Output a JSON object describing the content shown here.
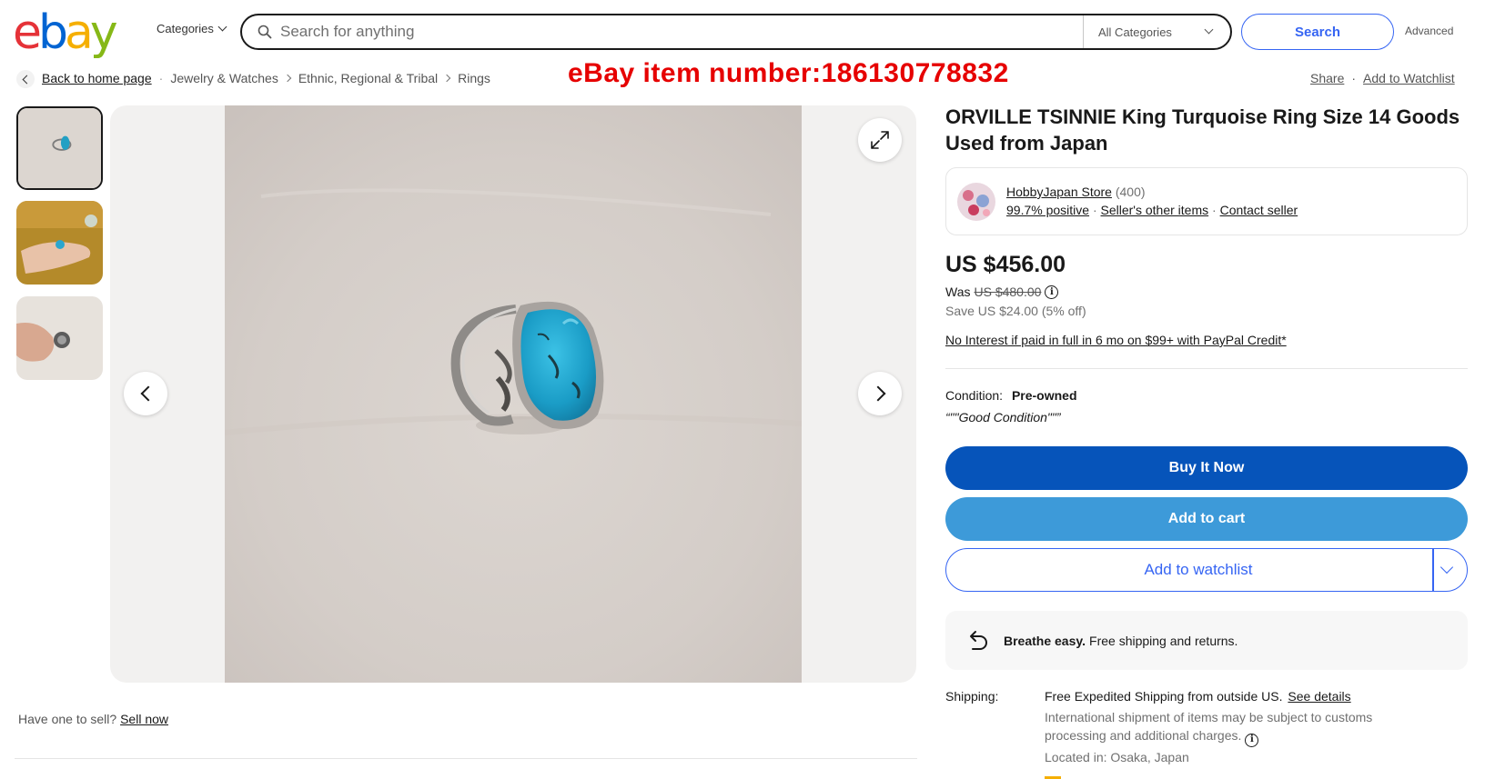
{
  "header": {
    "logo_letters": [
      "e",
      "b",
      "a",
      "y"
    ],
    "categories_label": "Categories",
    "search_placeholder": "Search for anything",
    "category_select": "All Categories",
    "search_button": "Search",
    "advanced_link": "Advanced"
  },
  "breadcrumb": {
    "home": "Back to home page",
    "items": [
      "Jewelry & Watches",
      "Ethnic, Regional & Tribal",
      "Rings"
    ]
  },
  "overlay_text": "eBay item number:186130778832",
  "top_links": {
    "share": "Share",
    "separator": "·",
    "watchlist": "Add to Watchlist"
  },
  "listing": {
    "title": "ORVILLE TSINNIE King Turquoise Ring Size 14 Goods Used from Japan",
    "seller": {
      "name": "HobbyJapan Store",
      "feedback_count": "(400)",
      "positive": "99.7% positive",
      "other_items": "Seller's other items",
      "contact": "Contact seller",
      "separator": "·"
    },
    "price": "US $456.00",
    "was_label": "Was",
    "was_price": "US $480.00",
    "save_text": "Save US $24.00 (5% off)",
    "paypal_credit": "No Interest if paid in full in 6 mo on $99+ with PayPal Credit*",
    "condition_label": "Condition:",
    "condition_value": "Pre-owned",
    "condition_quote": "“\"\"Good Condition\"\"”"
  },
  "buttons": {
    "buy_now": "Buy It Now",
    "add_to_cart": "Add to cart",
    "add_to_watchlist": "Add to watchlist"
  },
  "breathe": {
    "bold": "Breathe easy.",
    "text": "Free shipping and returns."
  },
  "shipping": {
    "label": "Shipping:",
    "free": "Free",
    "method": "Expedited Shipping from outside US.",
    "see_details": "See details",
    "note": "International shipment of items may be subject to customs processing and additional charges.",
    "located": "Located in: Osaka, Japan"
  },
  "sell": {
    "question": "Have one to sell?",
    "link": "Sell now"
  },
  "icons": {
    "search": "search-icon",
    "expand": "expand-icon",
    "prev": "chevron-left-icon",
    "next": "chevron-right-icon",
    "returns": "return-arrow-icon",
    "info": "info-icon"
  },
  "colors": {
    "logo_red": "#e53238",
    "logo_blue": "#0064d2",
    "logo_yellow": "#f5af02",
    "logo_green": "#86b817",
    "buy_now_bg": "#0654ba",
    "add_to_cart_bg": "#3d9ad9",
    "accent_blue": "#3665f3",
    "item_number_red": "#e60000"
  }
}
